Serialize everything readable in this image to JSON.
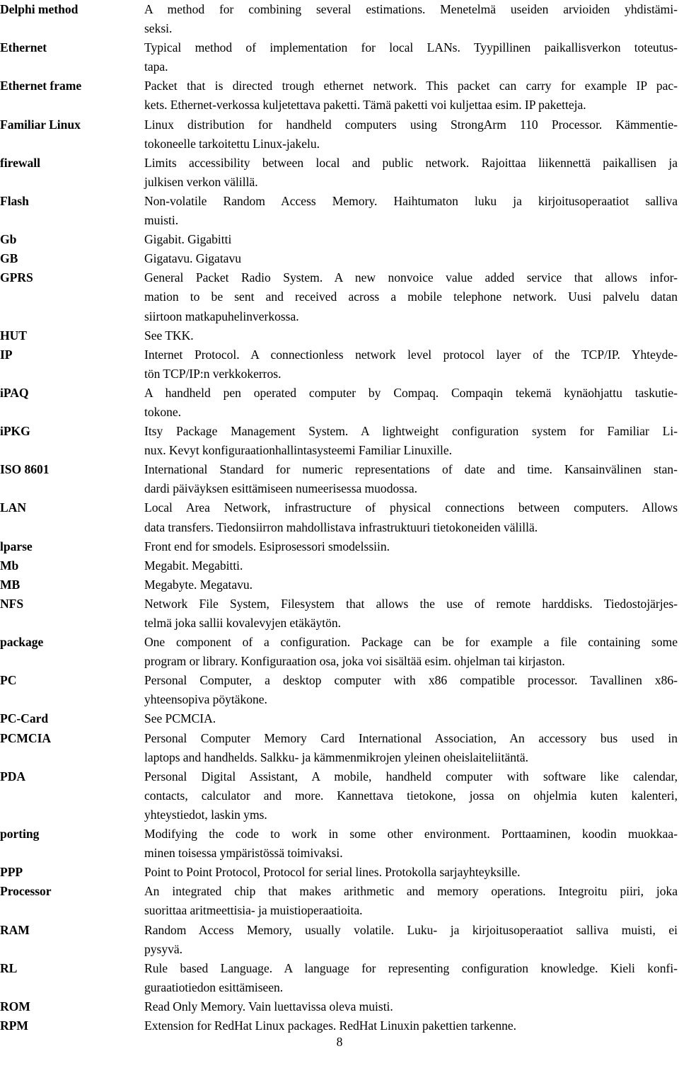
{
  "document": {
    "page_number": "8",
    "entries": [
      {
        "term": "Delphi method",
        "lines": [
          "A method for combining several estimations. Menetelmä useiden arvioiden yhdistämi-",
          "seksi."
        ]
      },
      {
        "term": "Ethernet",
        "lines": [
          "Typical method of implementation for local LANs. Tyypillinen paikallisverkon toteutus-",
          "tapa."
        ]
      },
      {
        "term": "Ethernet frame",
        "lines": [
          "Packet that is directed trough ethernet network. This packet can carry for example IP pac-",
          "kets. Ethernet-verkossa kuljetettava paketti. Tämä paketti voi kuljettaa esim. IP paketteja."
        ]
      },
      {
        "term": "Familiar Linux",
        "lines": [
          "Linux distribution for handheld computers using StrongArm 110 Processor. Kämmentie-",
          "tokoneelle tarkoitettu Linux-jakelu."
        ]
      },
      {
        "term": "firewall",
        "lines": [
          "Limits accessibility between local and public network. Rajoittaa liikennettä paikallisen ja",
          "julkisen verkon välillä."
        ]
      },
      {
        "term": "Flash",
        "lines": [
          "Non-volatile Random Access Memory. Haihtumaton luku ja kirjoitusoperaatiot salliva",
          "muisti."
        ]
      },
      {
        "term": "Gb",
        "lines": [
          "Gigabit. Gigabitti"
        ]
      },
      {
        "term": "GB",
        "lines": [
          "Gigatavu. Gigatavu"
        ]
      },
      {
        "term": "GPRS",
        "lines": [
          "General Packet Radio System. A new nonvoice value added service that allows infor-",
          "mation to be sent and received across a mobile telephone network. Uusi palvelu datan",
          "siirtoon matkapuhelinverkossa."
        ]
      },
      {
        "term": "HUT",
        "lines": [
          "See TKK."
        ]
      },
      {
        "term": "IP",
        "lines": [
          "Internet Protocol. A connectionless network level protocol layer of the TCP/IP. Yhteyde-",
          "tön TCP/IP:n verkkokerros."
        ]
      },
      {
        "term": "iPAQ",
        "lines": [
          "A handheld pen operated computer by Compaq. Compaqin tekemä kynäohjattu taskutie-",
          "tokone."
        ]
      },
      {
        "term": "iPKG",
        "lines": [
          "Itsy Package Management System. A lightweight configuration system for Familiar Li-",
          "nux. Kevyt konfiguraationhallintasysteemi Familiar Linuxille."
        ]
      },
      {
        "term": "ISO 8601",
        "lines": [
          "International Standard for numeric representations of date and time. Kansainvälinen stan-",
          "dardi päiväyksen esittämiseen numeerisessa muodossa."
        ]
      },
      {
        "term": "LAN",
        "lines": [
          "Local Area Network, infrastructure of physical connections between computers. Allows",
          "data transfers. Tiedonsiirron mahdollistava infrastruktuuri tietokoneiden välillä."
        ]
      },
      {
        "term": "lparse",
        "lines": [
          "Front end for smodels. Esiprosessori smodelssiin."
        ]
      },
      {
        "term": "Mb",
        "lines": [
          "Megabit. Megabitti."
        ]
      },
      {
        "term": "MB",
        "lines": [
          "Megabyte. Megatavu."
        ]
      },
      {
        "term": "NFS",
        "lines": [
          "Network File System, Filesystem that allows the use of remote harddisks. Tiedostojärjes-",
          "telmä joka sallii kovalevyjen etäkäytön."
        ]
      },
      {
        "term": "package",
        "lines": [
          "One component of a configuration. Package can be for example a file containing some",
          "program or library. Konfiguraation osa, joka voi sisältää esim. ohjelman tai kirjaston."
        ]
      },
      {
        "term": "PC",
        "lines": [
          "Personal Computer, a desktop computer with x86 compatible processor. Tavallinen x86-",
          "yhteensopiva pöytäkone."
        ]
      },
      {
        "term": "PC-Card",
        "lines": [
          "See PCMCIA."
        ]
      },
      {
        "term": "PCMCIA",
        "lines": [
          "Personal Computer Memory Card International Association, An accessory bus used in",
          "laptops and handhelds. Salkku- ja kämmenmikrojen yleinen oheislaiteliitäntä."
        ]
      },
      {
        "term": "PDA",
        "lines": [
          "Personal Digital Assistant, A mobile, handheld computer with software like calendar,",
          "contacts, calculator and more. Kannettava tietokone, jossa on ohjelmia kuten kalenteri,",
          "yhteystiedot, laskin yms."
        ]
      },
      {
        "term": "porting",
        "lines": [
          "Modifying the code to work in some other environment. Porttaaminen, koodin muokkaa-",
          "minen toisessa ympäristössä toimivaksi."
        ]
      },
      {
        "term": "PPP",
        "lines": [
          "Point to Point Protocol, Protocol for serial lines. Protokolla sarjayhteyksille."
        ]
      },
      {
        "term": "Processor",
        "lines": [
          "An integrated chip that makes arithmetic and memory operations. Integroitu piiri, joka",
          "suorittaa aritmeettisia- ja muistioperaatioita."
        ]
      },
      {
        "term": "RAM",
        "lines": [
          "Random Access Memory, usually volatile. Luku- ja kirjoitusoperaatiot salliva muisti, ei",
          "pysyvä."
        ]
      },
      {
        "term": "RL",
        "lines": [
          "Rule based Language. A language for representing configuration knowledge. Kieli konfi-",
          "guraatiotiedon esittämiseen."
        ]
      },
      {
        "term": "ROM",
        "lines": [
          "Read Only Memory. Vain luettavissa oleva muisti."
        ]
      },
      {
        "term": "RPM",
        "lines": [
          "Extension for RedHat Linux packages. RedHat Linuxin pakettien tarkenne."
        ]
      }
    ]
  }
}
